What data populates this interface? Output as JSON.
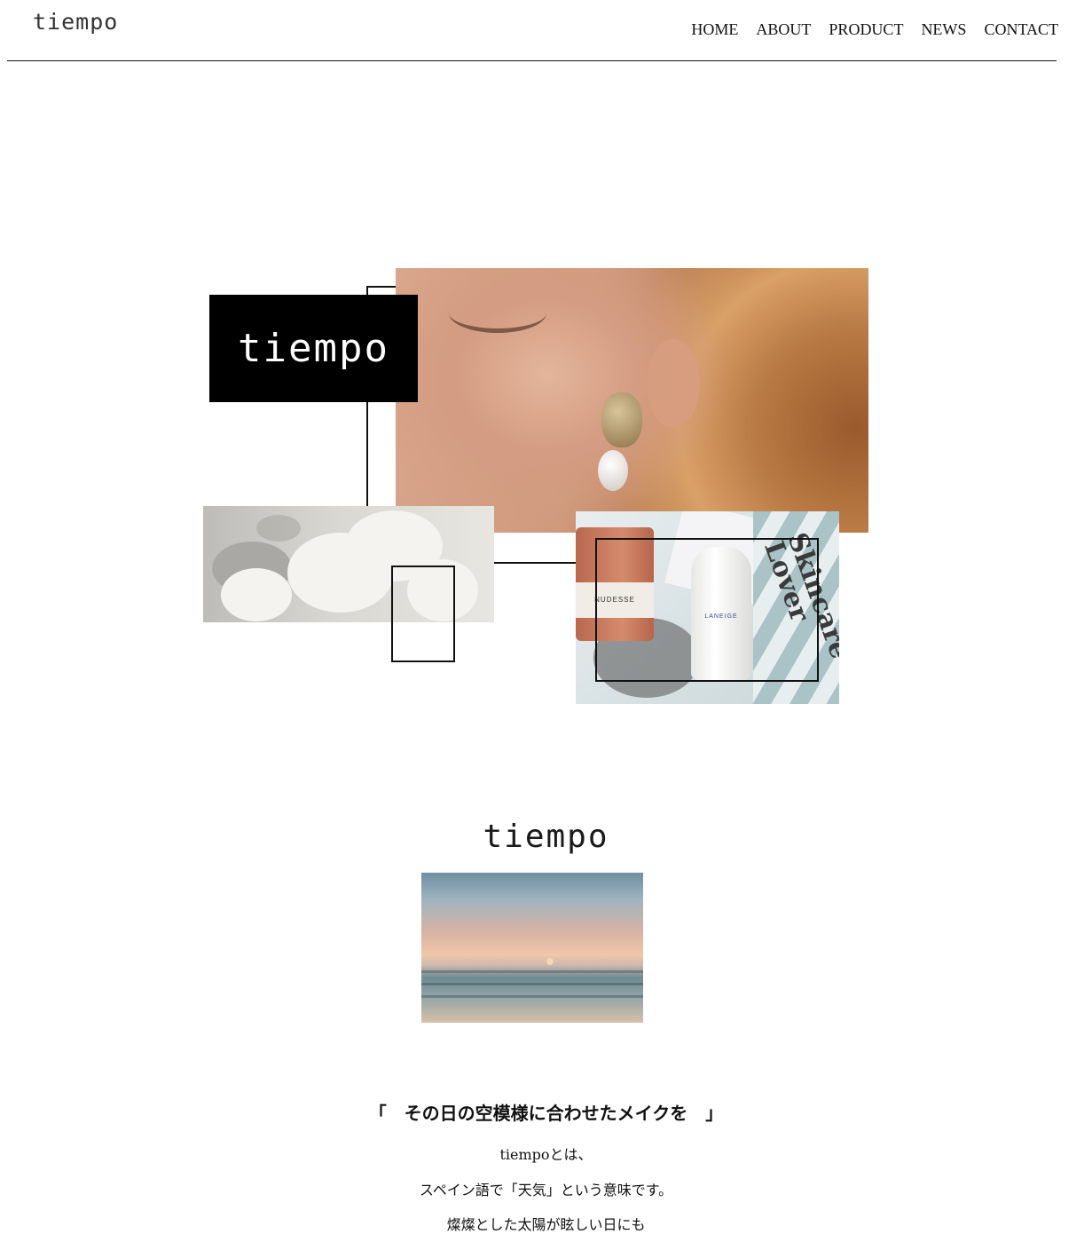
{
  "header": {
    "logo": "tiempo",
    "nav": [
      "HOME",
      "ABOUT",
      "PRODUCT",
      "NEWS",
      "CONTACT"
    ]
  },
  "hero": {
    "logo_text": "tiempo",
    "candle_label": "NUDESSE",
    "bottle_label": "LANEIGE",
    "sheet_text": "Skincare Lover"
  },
  "about": {
    "logo": "tiempo",
    "tagline": "「　その日の空模様に合わせたメイクを　」",
    "lines": [
      "tiempoとは、",
      "スペイン語で「天気」という意味です。",
      "燦燦とした太陽が眩しい日にも"
    ]
  },
  "colors": {
    "background": "#ffffff",
    "text": "#111111",
    "logo_box": "#000000"
  }
}
